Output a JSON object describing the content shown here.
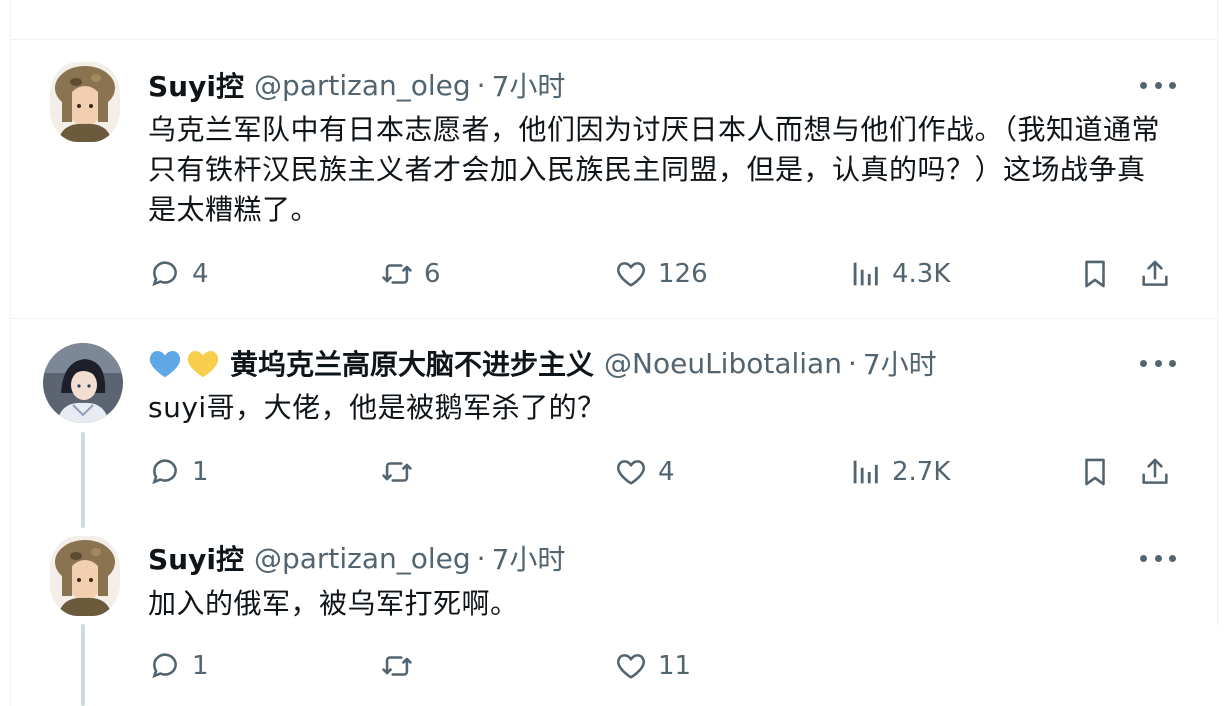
{
  "colors": {
    "text": "#0f1419",
    "secondary": "#536471",
    "divider": "#eff3f4",
    "thread_line": "#cfd9de",
    "blue_heart": "#5fa8e8",
    "yellow_heart": "#f8cf4d"
  },
  "tweets": [
    {
      "name": "Suyi控",
      "handle": "@partizan_oleg",
      "dot": "·",
      "time": "7小时",
      "text": "乌克兰军队中有日本志愿者，他们因为讨厌日本人而想与他们作战。（我知道通常只有铁杆汉民族主义者才会加入民族民主同盟，但是，认真的吗？）这场战争真是太糟糕了。",
      "replies": "4",
      "retweets": "6",
      "likes": "126",
      "views": "4.3K"
    },
    {
      "name_icons": [
        "blue-heart-icon",
        "yellow-heart-icon"
      ],
      "name": "黄坞克兰高原大脑不进步主义",
      "handle": "@NoeuLibotalian",
      "dot": "·",
      "time": "7小时",
      "text": "suyi哥，大佬，他是被鹅军杀了的？",
      "replies": "1",
      "retweets": "",
      "likes": "4",
      "views": "2.7K"
    },
    {
      "name": "Suyi控",
      "handle": "@partizan_oleg",
      "dot": "·",
      "time": "7小时",
      "text": "加入的俄军，被乌军打死啊。",
      "replies": "1",
      "retweets": "",
      "likes": "11"
    }
  ]
}
